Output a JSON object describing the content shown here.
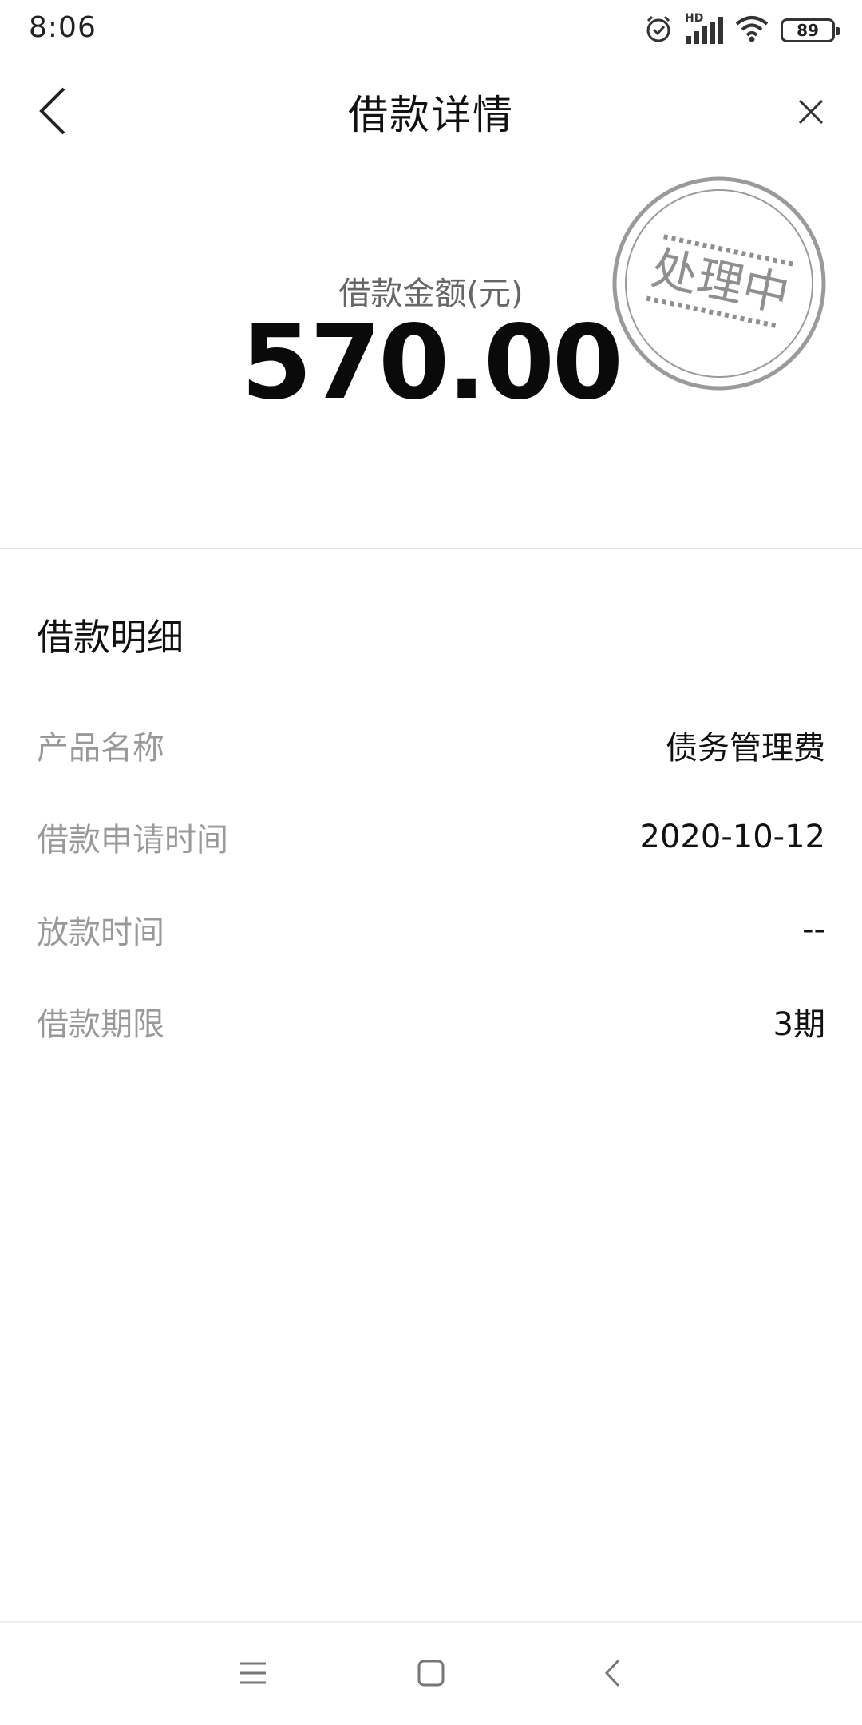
{
  "status_bar": {
    "time": "8:06",
    "hd_label": "HD",
    "battery_level": "89",
    "icons": [
      "alarm-icon",
      "signal-icon",
      "wifi-icon",
      "battery-icon"
    ]
  },
  "header": {
    "title": "借款详情",
    "back_icon": "chevron-left-icon",
    "close_icon": "close-icon"
  },
  "amount": {
    "label": "借款金额(元)",
    "value": "570.00"
  },
  "stamp": {
    "text": "处理中",
    "color": "#8f8f8f"
  },
  "details": {
    "title": "借款明细",
    "rows": [
      {
        "label": "产品名称",
        "value": "债务管理费"
      },
      {
        "label": "借款申请时间",
        "value": "2020-10-12"
      },
      {
        "label": "放款时间",
        "value": "--"
      },
      {
        "label": "借款期限",
        "value": "3期"
      }
    ]
  },
  "nav": {
    "icons": [
      "menu-icon",
      "home-icon",
      "back-icon"
    ]
  }
}
